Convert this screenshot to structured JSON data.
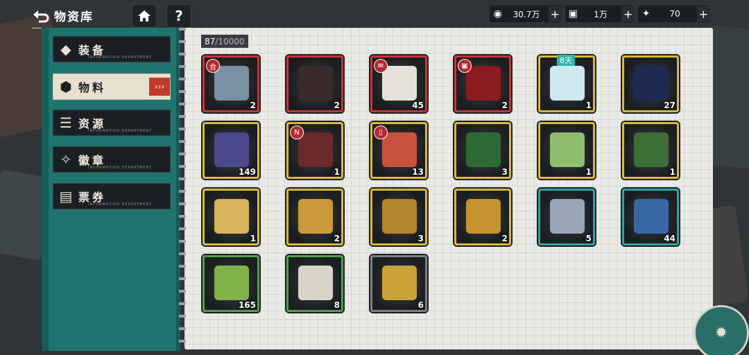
{
  "header": {
    "title": "物资库",
    "home_icon": "home-icon",
    "help_label": "?"
  },
  "currencies": [
    {
      "icon": "coin-icon",
      "value": "30.7万",
      "plus": "+"
    },
    {
      "icon": "ticket-icon",
      "value": "1万",
      "plus": "+"
    },
    {
      "icon": "crystal-icon",
      "value": "70",
      "plus": "+"
    }
  ],
  "sidebar": {
    "items": [
      {
        "label": "装备",
        "icon": "equipment-icon",
        "sub": "INFORMATION DEPARTMENT",
        "selected": false
      },
      {
        "label": "物料",
        "icon": "materials-icon",
        "sub": "INFORMATION DEPARTMENT",
        "selected": true
      },
      {
        "label": "资源",
        "icon": "resources-icon",
        "sub": "INFORMATION DEPARTMENT",
        "selected": false
      },
      {
        "label": "徽章",
        "icon": "badge-icon",
        "sub": "INFORMATION DEPARTMENT",
        "selected": false
      },
      {
        "label": "票券",
        "icon": "voucher-icon",
        "sub": "INFORMATION DEPARTMENT",
        "selected": false
      }
    ]
  },
  "inventory": {
    "capacity_current": "87",
    "capacity_max": "/10000",
    "items": [
      {
        "name": "letters-bundle",
        "count": "2",
        "rarity": "red",
        "color": "#7a8fa0",
        "tag": "合"
      },
      {
        "name": "socio-logy-book",
        "count": "2",
        "rarity": "red",
        "color": "#3a2c2a"
      },
      {
        "name": "sealed-envelope",
        "count": "45",
        "rarity": "red",
        "color": "#e6e1d8",
        "tag": "✉"
      },
      {
        "name": "red-application",
        "count": "2",
        "rarity": "red",
        "color": "#8c1b1f",
        "tag": "▣"
      },
      {
        "name": "spray-bottle",
        "count": "1",
        "rarity": "yellow",
        "color": "#cfe8ef",
        "timer": "8天"
      },
      {
        "name": "philosophy-book",
        "count": "27",
        "rarity": "yellow",
        "color": "#1e2a52"
      },
      {
        "name": "battery-cell",
        "count": "149",
        "rarity": "yellow",
        "color": "#4a4a8c"
      },
      {
        "name": "key-card",
        "count": "1",
        "rarity": "yellow",
        "color": "#6a2a2c",
        "tag": "N"
      },
      {
        "name": "red-ticket",
        "count": "13",
        "rarity": "yellow",
        "color": "#c9523e",
        "tag": "▯"
      },
      {
        "name": "tea-bowl",
        "count": "3",
        "rarity": "yellow",
        "color": "#2f6b34"
      },
      {
        "name": "tea-leaves-bowl",
        "count": "1",
        "rarity": "yellow",
        "color": "#8fbf6e"
      },
      {
        "name": "tea-dish",
        "count": "1",
        "rarity": "yellow",
        "color": "#3c6e36"
      },
      {
        "name": "open-book",
        "count": "1",
        "rarity": "yellow",
        "color": "#d8b45a"
      },
      {
        "name": "cloud-token",
        "count": "2",
        "rarity": "yellow",
        "color": "#c99a3b"
      },
      {
        "name": "brass-tools",
        "count": "3",
        "rarity": "yellow",
        "color": "#b2862c"
      },
      {
        "name": "gold-structure",
        "count": "2",
        "rarity": "yellow",
        "color": "#c7932f"
      },
      {
        "name": "manual-booklet",
        "count": "5",
        "rarity": "teal",
        "color": "#9aa6b8"
      },
      {
        "name": "blue-canister",
        "count": "44",
        "rarity": "teal",
        "color": "#3a67a6"
      },
      {
        "name": "green-canister",
        "count": "165",
        "rarity": "green",
        "color": "#7fb34a"
      },
      {
        "name": "document-box",
        "count": "8",
        "rarity": "green",
        "color": "#d9d4c8"
      },
      {
        "name": "orb-capsule",
        "count": "6",
        "rarity": "gray",
        "color": "#c9a236"
      }
    ]
  },
  "emblem": {
    "icon": "compass-emblem-icon"
  }
}
